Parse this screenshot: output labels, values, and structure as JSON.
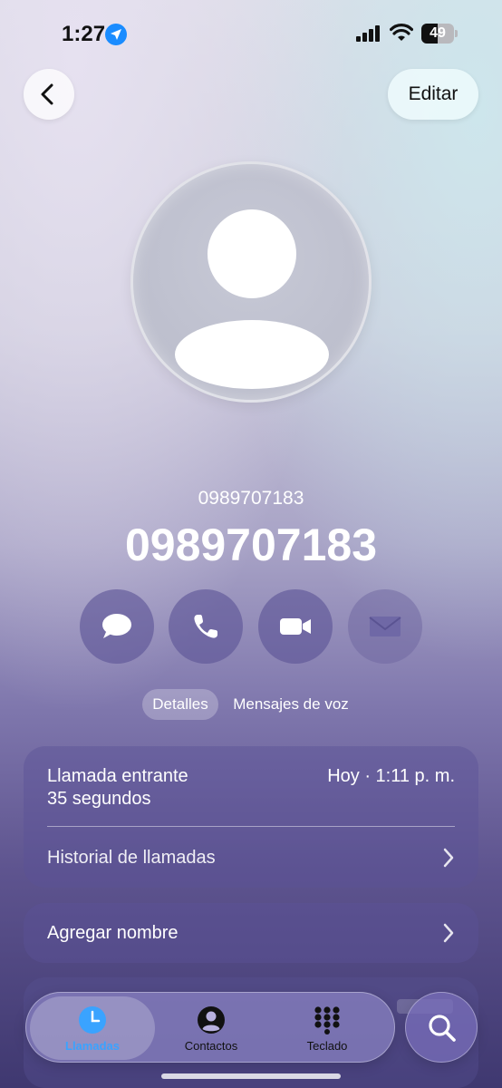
{
  "status_bar": {
    "time": "1:27",
    "battery": "49",
    "battery_level": 0.49
  },
  "nav": {
    "edit_label": "Editar"
  },
  "contact": {
    "subtitle": "0989707183",
    "title": "0989707183"
  },
  "actions": [
    {
      "icon": "message-icon"
    },
    {
      "icon": "phone-icon"
    },
    {
      "icon": "video-icon"
    },
    {
      "icon": "mail-icon",
      "disabled": true
    }
  ],
  "segments": {
    "details": "Detalles",
    "voicemail": "Mensajes de voz"
  },
  "call_card": {
    "type": "Llamada entrante",
    "duration": "35 segundos",
    "time": "Hoy · 1:11 p. m.",
    "history_label": "Historial de llamadas"
  },
  "add_name_label": "Agregar nombre",
  "tab_bar": {
    "calls": "Llamadas",
    "contacts": "Contactos",
    "keypad": "Teclado"
  },
  "colors": {
    "accent": "#3aa3ff",
    "location": "#1a8cff"
  }
}
